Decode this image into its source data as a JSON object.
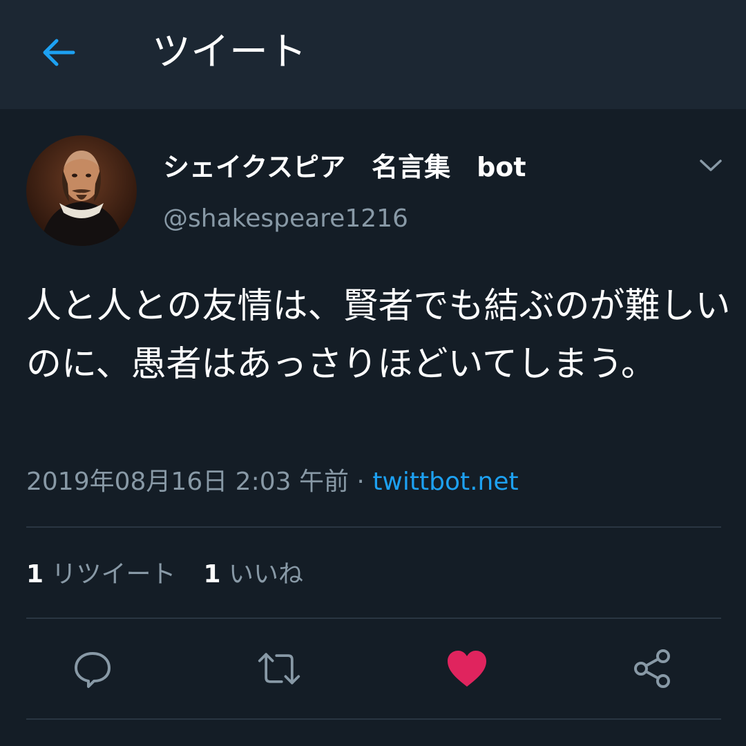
{
  "header": {
    "title": "ツイート",
    "back_icon": "arrow-left-icon"
  },
  "tweet": {
    "display_name": "シェイクスピア　名言集　bot",
    "handle": "@shakespeare1216",
    "text": "人と人との友情は、賢者でも結ぶのが難しいのに、愚者はあっさりほどいてしまう。",
    "timestamp": "2019年08月16日 2:03 午前",
    "separator": " · ",
    "source": "twittbot.net",
    "retweet_count": "1",
    "retweet_label": "リツイート",
    "like_count": "1",
    "like_label": "いいね"
  },
  "actions": {
    "reply_icon": "reply-icon",
    "retweet_icon": "retweet-icon",
    "like_icon": "heart-icon",
    "share_icon": "share-icon"
  },
  "colors": {
    "background": "#141d26",
    "header_bg": "#1c2733",
    "accent": "#1da1f2",
    "muted": "#8899a6",
    "like": "#e0245e"
  }
}
